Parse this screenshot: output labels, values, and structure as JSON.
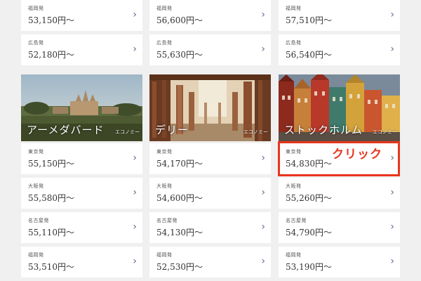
{
  "columns": [
    {
      "top_cards": [
        {
          "from": "福岡発",
          "price": "53,150円〜"
        },
        {
          "from": "広島発",
          "price": "52,180円〜"
        }
      ],
      "destination": {
        "name": "アーメダバード",
        "class": "エコノミー"
      },
      "cards": [
        {
          "from": "東京発",
          "price": "55,150円〜"
        },
        {
          "from": "大阪発",
          "price": "55,580円〜"
        },
        {
          "from": "名古屋発",
          "price": "55,110円〜"
        },
        {
          "from": "福岡発",
          "price": "53,510円〜"
        }
      ]
    },
    {
      "top_cards": [
        {
          "from": "福岡発",
          "price": "56,600円〜"
        },
        {
          "from": "広島発",
          "price": "55,630円〜"
        }
      ],
      "destination": {
        "name": "デリー",
        "class": "エコノミー"
      },
      "cards": [
        {
          "from": "東京発",
          "price": "54,170円〜"
        },
        {
          "from": "大阪発",
          "price": "54,600円〜"
        },
        {
          "from": "名古屋発",
          "price": "54,130円〜"
        },
        {
          "from": "福岡発",
          "price": "52,530円〜"
        }
      ]
    },
    {
      "top_cards": [
        {
          "from": "福岡発",
          "price": "57,510円〜"
        },
        {
          "from": "広島発",
          "price": "56,540円〜"
        }
      ],
      "destination": {
        "name": "ストックホルム",
        "class": "エコノミー"
      },
      "cards": [
        {
          "from": "東京発",
          "price": "54,830円〜"
        },
        {
          "from": "大阪発",
          "price": "55,260円〜"
        },
        {
          "from": "名古屋発",
          "price": "54,790円〜"
        },
        {
          "from": "福岡発",
          "price": "53,190円〜"
        }
      ]
    }
  ],
  "chevron": "›",
  "annotation": {
    "text": "クリック",
    "color": "#e8361e"
  }
}
